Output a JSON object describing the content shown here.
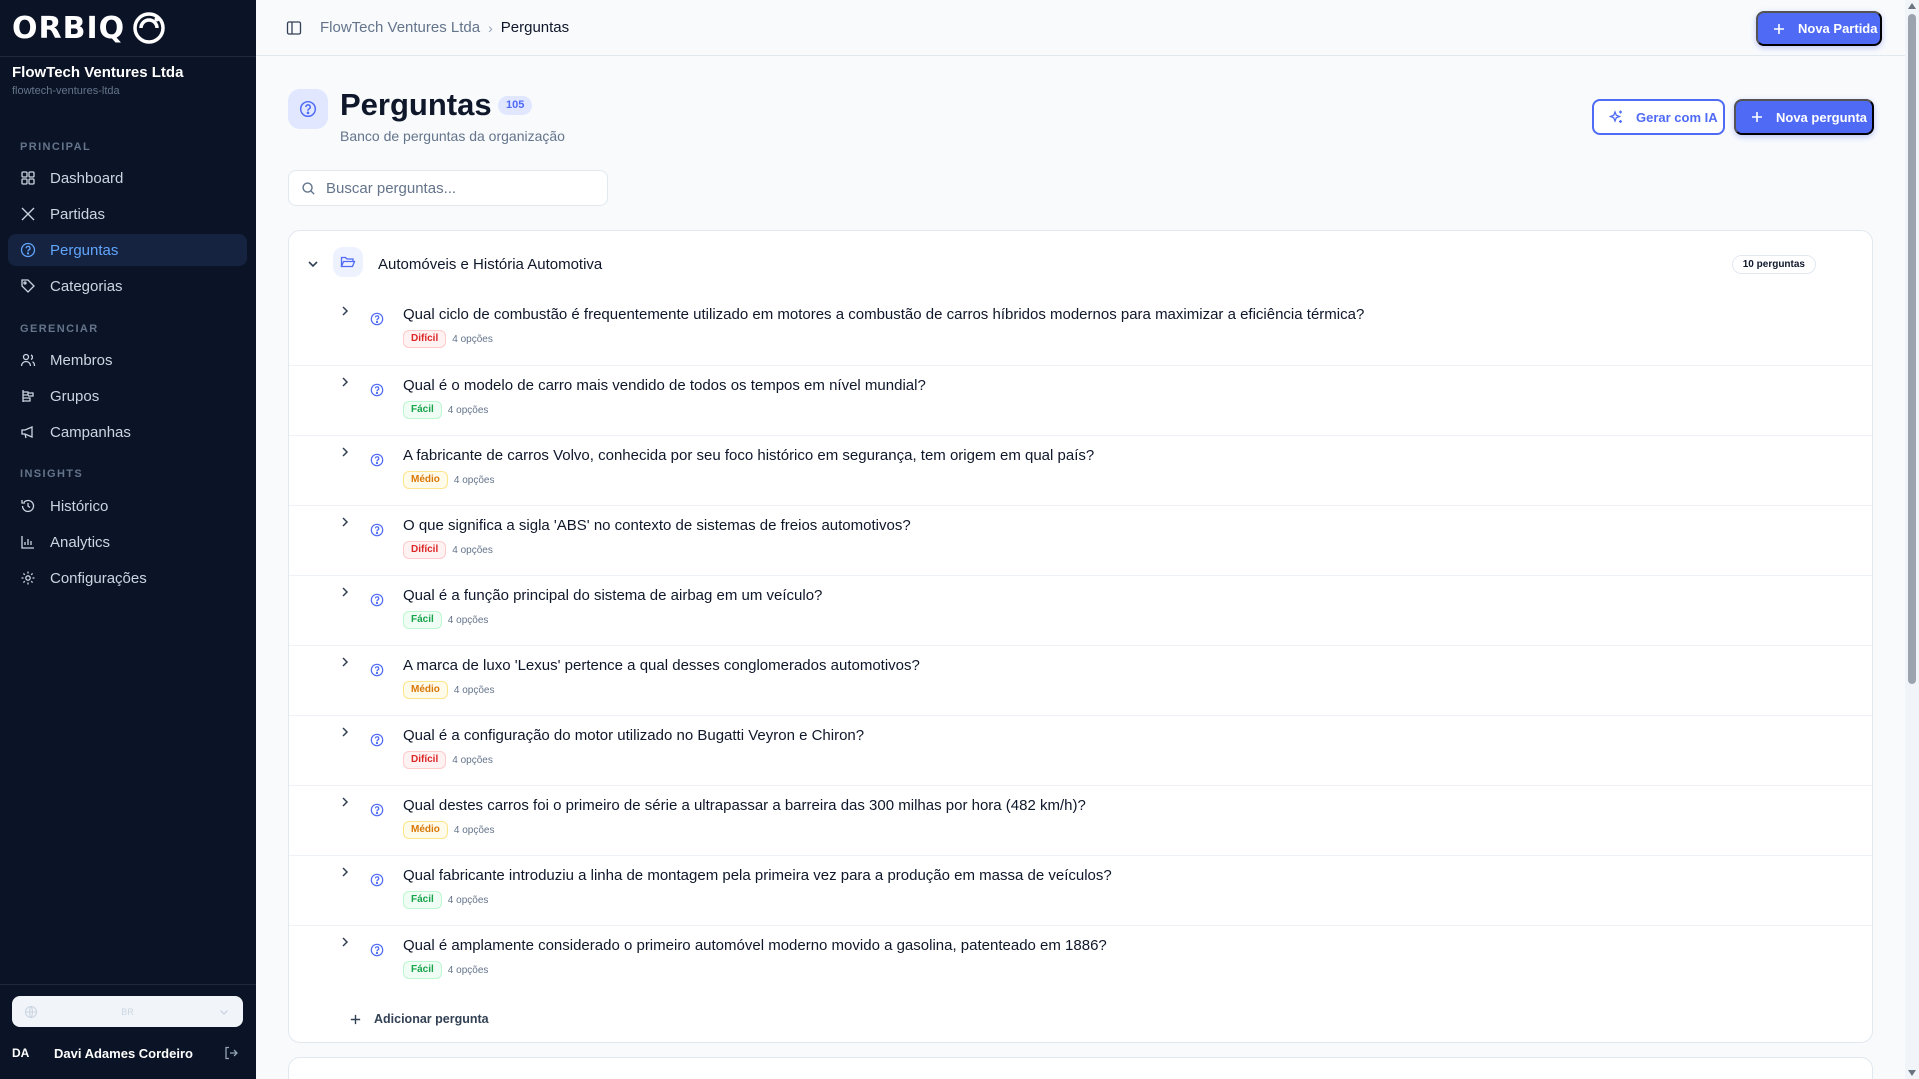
{
  "brand": {
    "logo_text": "ORBIQ"
  },
  "org": {
    "name": "FlowTech Ventures Ltda",
    "slug": "flowtech-ventures-ltda"
  },
  "sidebar": {
    "sections": [
      {
        "label": "PRINCIPAL"
      },
      {
        "label": "GERENCIAR"
      },
      {
        "label": "INSIGHTS"
      }
    ],
    "items": [
      {
        "label": "Dashboard",
        "icon": "dashboard-icon"
      },
      {
        "label": "Partidas",
        "icon": "swords-icon"
      },
      {
        "label": "Perguntas",
        "icon": "question-circle-icon",
        "active": true
      },
      {
        "label": "Categorias",
        "icon": "tag-icon"
      },
      {
        "label": "Membros",
        "icon": "users-icon"
      },
      {
        "label": "Grupos",
        "icon": "groups-icon"
      },
      {
        "label": "Campanhas",
        "icon": "megaphone-icon"
      },
      {
        "label": "Histórico",
        "icon": "history-icon"
      },
      {
        "label": "Analytics",
        "icon": "bar-chart-icon"
      },
      {
        "label": "Configurações",
        "icon": "gear-icon"
      }
    ],
    "language": {
      "code": "BR"
    },
    "user": {
      "initials": "DA",
      "name": "Davi Adames Cordeiro"
    }
  },
  "topbar": {
    "breadcrumb": [
      "FlowTech Ventures Ltda",
      "Perguntas"
    ],
    "new_match_label": "Nova Partida"
  },
  "page": {
    "title": "Perguntas",
    "count": "105",
    "subtitle": "Banco de perguntas da organização",
    "generate_ai_label": "Gerar com IA",
    "new_question_label": "Nova pergunta",
    "search_placeholder": "Buscar perguntas..."
  },
  "category": {
    "name": "Automóveis e História Automotiva",
    "count_label": "10 perguntas",
    "add_question_label": "Adicionar pergunta",
    "questions": [
      {
        "text": "Qual ciclo de combustão é frequentemente utilizado em motores a combustão de carros híbridos modernos para maximizar a eficiência térmica?",
        "difficulty": "Difícil",
        "level": "dificil",
        "options": "4 opções"
      },
      {
        "text": "Qual é o modelo de carro mais vendido de todos os tempos em nível mundial?",
        "difficulty": "Fácil",
        "level": "facil",
        "options": "4 opções"
      },
      {
        "text": "A fabricante de carros Volvo, conhecida por seu foco histórico em segurança, tem origem em qual país?",
        "difficulty": "Médio",
        "level": "medio",
        "options": "4 opções"
      },
      {
        "text": "O que significa a sigla 'ABS' no contexto de sistemas de freios automotivos?",
        "difficulty": "Difícil",
        "level": "dificil",
        "options": "4 opções"
      },
      {
        "text": "Qual é a função principal do sistema de airbag em um veículo?",
        "difficulty": "Fácil",
        "level": "facil",
        "options": "4 opções"
      },
      {
        "text": "A marca de luxo 'Lexus' pertence a qual desses conglomerados automotivos?",
        "difficulty": "Médio",
        "level": "medio",
        "options": "4 opções"
      },
      {
        "text": "Qual é a configuração do motor utilizado no Bugatti Veyron e Chiron?",
        "difficulty": "Difícil",
        "level": "dificil",
        "options": "4 opções"
      },
      {
        "text": "Qual destes carros foi o primeiro de série a ultrapassar a barreira das 300 milhas por hora (482 km/h)?",
        "difficulty": "Médio",
        "level": "medio",
        "options": "4 opções"
      },
      {
        "text": "Qual fabricante introduziu a linha de montagem pela primeira vez para a produção em massa de veículos?",
        "difficulty": "Fácil",
        "level": "facil",
        "options": "4 opções"
      },
      {
        "text": "Qual é amplamente considerado o primeiro automóvel moderno movido a gasolina, patenteado em 1886?",
        "difficulty": "Fácil",
        "level": "facil",
        "options": "4 opções"
      }
    ]
  },
  "colors": {
    "accent": "#4f6af5",
    "sidebar_bg": "#0b1426",
    "active_text": "#60a5fa"
  }
}
